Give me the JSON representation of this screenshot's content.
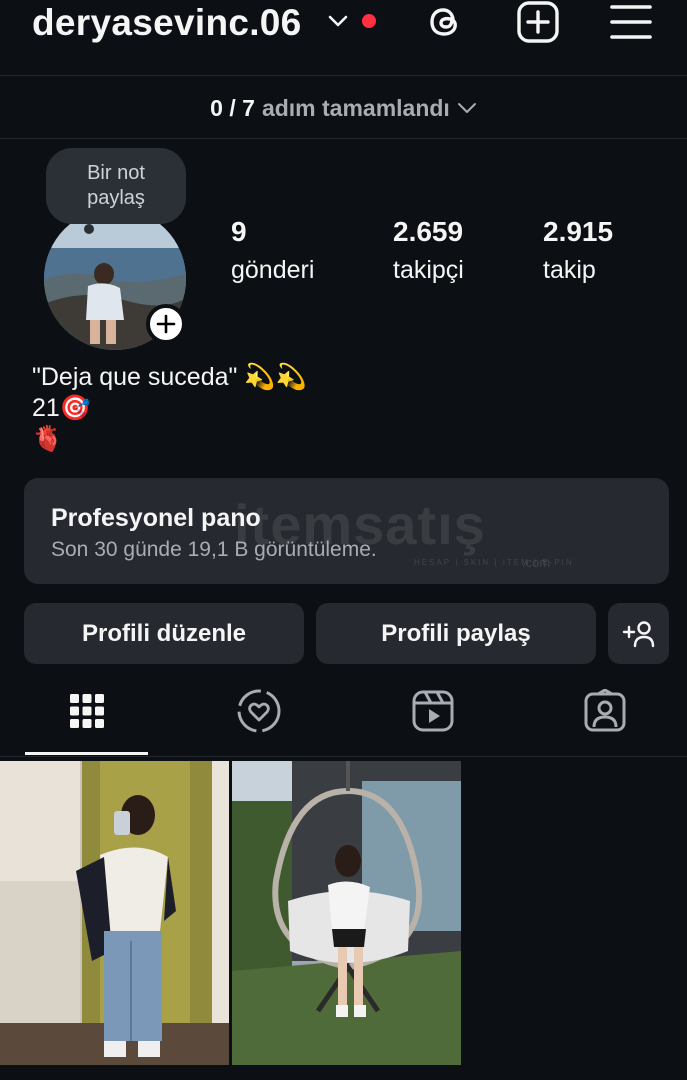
{
  "header": {
    "username": "deryasevinc.06",
    "icons": [
      "chevron-down-icon",
      "notification-dot",
      "threads-icon",
      "add-post-icon",
      "menu-icon"
    ],
    "accent_red": "#ff3040"
  },
  "steps": {
    "count": "0 / 7",
    "label": "adım tamamlandı"
  },
  "note": {
    "text_line1": "Bir not",
    "text_line2": "paylaş"
  },
  "stats": {
    "posts_count": "9",
    "posts_label": "gönderi",
    "followers_count": "2.659",
    "followers_label": "takipçi",
    "following_count": "2.915",
    "following_label": "takip"
  },
  "bio": {
    "line1": "\"Deja que suceda\" 💫💫",
    "line2": "21🎯",
    "line3": "🫀"
  },
  "professional": {
    "title": "Profesyonel pano",
    "subtitle": "Son 30 günde 19,1 B görüntüleme."
  },
  "watermark": {
    "brand": "itemsatış",
    "tagline": "HESAP | SKIN | ITEM | E-PIN",
    "domain": ".com"
  },
  "actions": {
    "edit_label": "Profili düzenle",
    "share_label": "Profili paylaş"
  },
  "tabs": [
    "grid-icon",
    "tagged-heart-icon",
    "reels-icon",
    "tagged-person-icon"
  ],
  "theme": {
    "background": "#0c1015",
    "surface": "#262a30",
    "text": "#f5f5f5",
    "muted": "#a8acb3"
  }
}
